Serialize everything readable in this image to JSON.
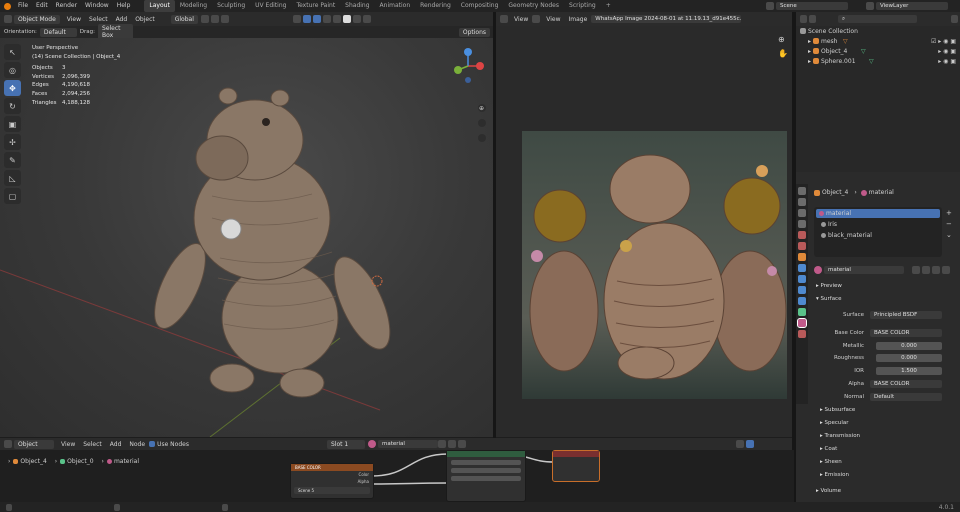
{
  "top_menu": [
    "File",
    "Edit",
    "Render",
    "Window",
    "Help"
  ],
  "workspaces": [
    "Layout",
    "Modeling",
    "Sculpting",
    "UV Editing",
    "Texture Paint",
    "Shading",
    "Animation",
    "Rendering",
    "Compositing",
    "Geometry Nodes",
    "Scripting"
  ],
  "scene": "Scene",
  "view_layer": "ViewLayer",
  "viewport": {
    "mode": "Object Mode",
    "menus": [
      "View",
      "Select",
      "Add",
      "Object"
    ],
    "transform": "Global",
    "orientation_label": "Orientation:",
    "orientation": "Default",
    "drag_label": "Drag:",
    "drag": "Select Box",
    "options": "Options",
    "perspective": "User Perspective",
    "collection": "(14) Scene Collection | Object_4",
    "stats": [
      {
        "k": "Objects",
        "v": "3"
      },
      {
        "k": "Vertices",
        "v": "2,096,399"
      },
      {
        "k": "Edges",
        "v": "4,190,618"
      },
      {
        "k": "Faces",
        "v": "2,094,256"
      },
      {
        "k": "Triangles",
        "v": "4,188,128"
      }
    ]
  },
  "image_editor": {
    "menus": [
      "View",
      "View",
      "Image"
    ],
    "image_name": "WhatsApp Image 2024-08-01 at 11.19.13_d91e455c.jpg"
  },
  "outliner": {
    "root": "Scene Collection",
    "items": [
      "mesh",
      "Object_4",
      "Sphere.001"
    ]
  },
  "properties": {
    "object": "Object_4",
    "material_tab": "material",
    "slots": [
      "material",
      "Iris",
      "black_material"
    ],
    "material_name": "material",
    "preview": "Preview",
    "surface_section": "Surface",
    "surface_label": "Surface",
    "surface_value": "Principled BSDF",
    "base_color_label": "Base Color",
    "base_color_value": "BASE COLOR",
    "metallic_label": "Metallic",
    "metallic_value": "0.000",
    "roughness_label": "Roughness",
    "roughness_value": "0.000",
    "ior_label": "IOR",
    "ior_value": "1.500",
    "alpha_label": "Alpha",
    "alpha_value": "BASE COLOR",
    "normal_label": "Normal",
    "normal_value": "Default",
    "sections": [
      "Subsurface",
      "Specular",
      "Transmission",
      "Coat",
      "Sheen",
      "Emission"
    ],
    "volume": "Volume"
  },
  "node_editor": {
    "mode": "Object",
    "menus": [
      "View",
      "Select",
      "Add",
      "Node"
    ],
    "use_nodes": "Use Nodes",
    "slot": "Slot 1",
    "material": "material",
    "breadcrumb": [
      "Object_4",
      "Object_0",
      "material"
    ],
    "image_node": "BASE COLOR",
    "image_in": "Scene 5"
  },
  "version": "4.0.1",
  "colors": {
    "accent": "#4772b3",
    "select": "#f08a24"
  }
}
